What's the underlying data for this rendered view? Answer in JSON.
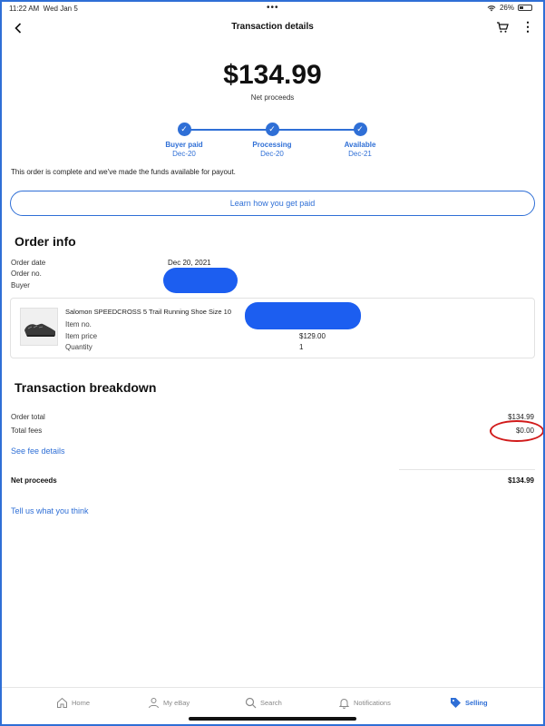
{
  "status_bar": {
    "time": "11:22 AM",
    "date": "Wed Jan 5",
    "battery": "26%"
  },
  "nav": {
    "title": "Transaction details"
  },
  "proceeds": {
    "amount": "$134.99",
    "label": "Net proceeds"
  },
  "steps": [
    {
      "name": "Buyer paid",
      "date": "Dec-20"
    },
    {
      "name": "Processing",
      "date": "Dec-20"
    },
    {
      "name": "Available",
      "date": "Dec-21"
    }
  ],
  "complete_message": "This order is complete and we've made the funds available for payout.",
  "learn_button": "Learn how you get paid",
  "order_info": {
    "title": "Order info",
    "order_date_label": "Order date",
    "order_date": "Dec 20, 2021",
    "order_no_label": "Order no.",
    "buyer_label": "Buyer"
  },
  "item": {
    "title": "Salomon SPEEDCROSS 5 Trail Running Shoe Size 10",
    "item_no_label": "Item no.",
    "item_price_label": "Item price",
    "item_price": "$129.00",
    "quantity_label": "Quantity",
    "quantity": "1"
  },
  "breakdown": {
    "title": "Transaction breakdown",
    "order_total_label": "Order total",
    "order_total": "$134.99",
    "total_fees_label": "Total fees",
    "total_fees": "$0.00",
    "fee_details_link": "See fee details",
    "net_proceeds_label": "Net proceeds",
    "net_proceeds": "$134.99"
  },
  "feedback_link": "Tell us what you think",
  "tabs": [
    {
      "label": "Home",
      "icon": "home-icon"
    },
    {
      "label": "My eBay",
      "icon": "person-icon"
    },
    {
      "label": "Search",
      "icon": "search-icon"
    },
    {
      "label": "Notifications",
      "icon": "bell-icon"
    },
    {
      "label": "Selling",
      "icon": "tag-icon",
      "active": true
    }
  ],
  "colors": {
    "accent": "#2f6fd6",
    "redaction": "#1c5ef0",
    "annotation": "#d11a1a"
  }
}
